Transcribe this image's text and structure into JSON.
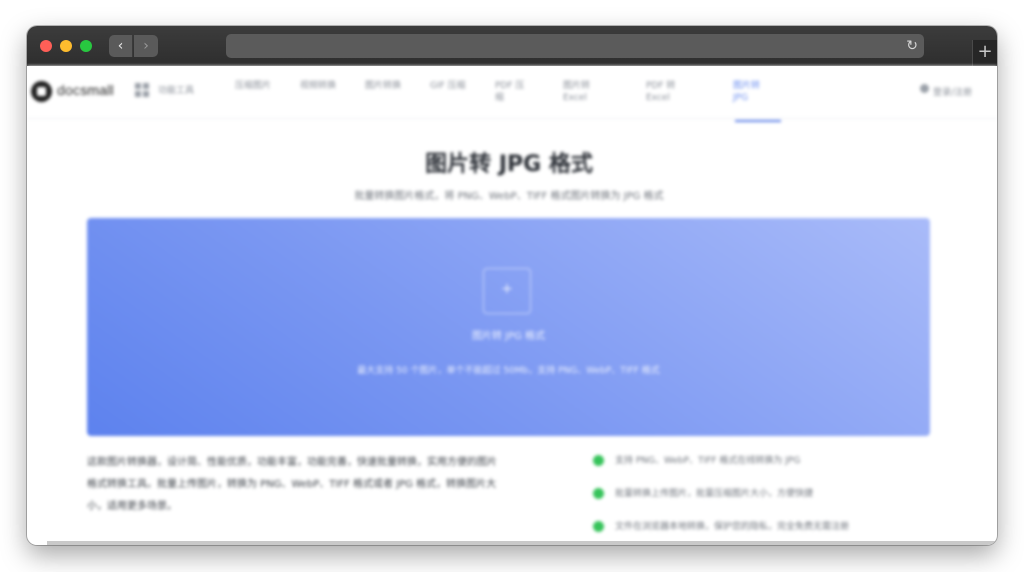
{
  "browser": {
    "back_glyph": "‹",
    "forward_glyph": "›",
    "reload_glyph": "↻",
    "newtab_glyph": "+",
    "url": ""
  },
  "site": {
    "logo_prefix": "doc",
    "logo_suffix": "small",
    "nav": [
      {
        "label": "功能工具"
      },
      {
        "label": "压缩图片"
      },
      {
        "label": "视频转换"
      },
      {
        "label": "图片转换"
      },
      {
        "label": "GIF 压缩"
      },
      {
        "label": "PDF 压缩"
      },
      {
        "label": "图片转 Excel"
      },
      {
        "label": "PDF 转 Excel"
      },
      {
        "label": "图片转 JPG"
      }
    ],
    "login_label": "登录/注册"
  },
  "main": {
    "title": "图片转 JPG 格式",
    "subtitle": "批量转换图片格式，将 PNG、WebP、TIFF 格式图片转换为 JPG 格式",
    "dropzone": {
      "icon": "+",
      "title": "图片转 JPG 格式",
      "hint": "最大支持 50 个图片，单个不能超过 50Mb，支持 PNG、WebP、TIFF 格式"
    },
    "description": "这款图片转换器，设计简、性能优质，功能丰富，功能完善，快速批量转换，实用方便的图片格式转换工具。批量上传图片，转换为 PNG、WebP、TIFF 格式或者 JPG 格式，转换图片大小，适用更多场景。",
    "features": [
      "支持 PNG、WebP、TIFF 格式在线转换为 JPG",
      "批量转换上传图片，批量压缩图片大小，方便快捷",
      "文件在浏览器本地转换，保护您的隐私，完全免费无需注册"
    ]
  },
  "colors": {
    "accent": "#5b7fe8",
    "feature_dot": "#36c35a"
  }
}
